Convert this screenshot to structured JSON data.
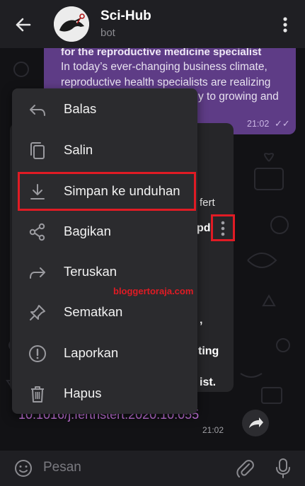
{
  "header": {
    "title": "Sci-Hub",
    "subtitle": "bot"
  },
  "purple_bubble": {
    "line1": "for the reproductive medicine specialist",
    "line2": "In today’s ever-changing business climate,",
    "line3": "reproductive health specialists are realizing",
    "line4": "y to growing and",
    "time": "21:02",
    "check": "✓✓"
  },
  "dark_bubble": {
    "frag1": "fert",
    "frag2": "pd",
    "frag3": ",",
    "frag4": "ting",
    "frag5": "ist.",
    "link": "10.1016/j.fertnstert.2020.10.055",
    "time": "21:02"
  },
  "menu": {
    "items": [
      {
        "label": "Balas",
        "icon": "reply-icon"
      },
      {
        "label": "Salin",
        "icon": "copy-icon"
      },
      {
        "label": "Simpan ke unduhan",
        "icon": "download-icon"
      },
      {
        "label": "Bagikan",
        "icon": "share-icon"
      },
      {
        "label": "Teruskan",
        "icon": "forward-icon"
      },
      {
        "label": "Sematkan",
        "icon": "pin-icon"
      },
      {
        "label": "Laporkan",
        "icon": "report-icon"
      },
      {
        "label": "Hapus",
        "icon": "delete-icon"
      }
    ]
  },
  "watermark": "bloggertoraja.com",
  "input": {
    "placeholder": "Pesan"
  },
  "colors": {
    "accent_red": "#e01b24",
    "purple_bubble": "#5e3c86",
    "link": "#c876e0"
  }
}
